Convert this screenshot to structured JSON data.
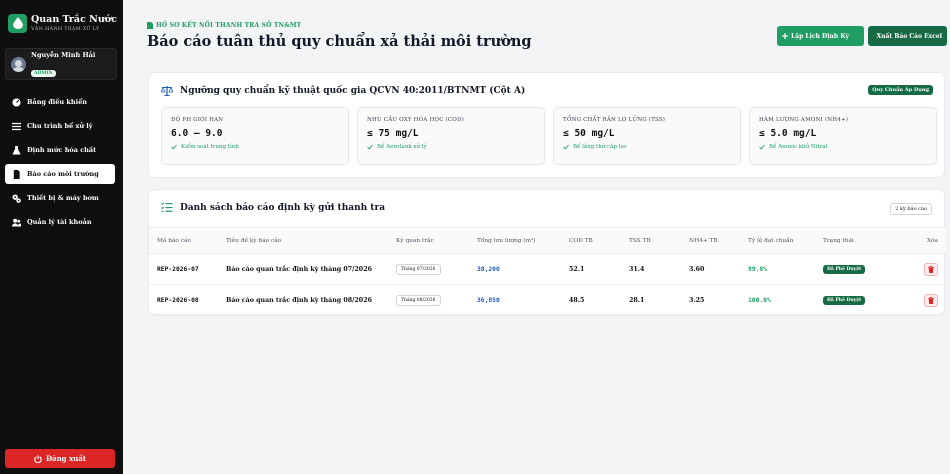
{
  "brand": {
    "title": "Quan Trắc Nước",
    "subtitle": "VẬN HÀNH TRẠM XỬ LÝ"
  },
  "user": {
    "name": "Nguyễn Minh Hải",
    "role": "ADMIN"
  },
  "nav": [
    {
      "label": "Bảng điều khiển",
      "icon": "speedometer-icon"
    },
    {
      "label": "Chu trình bể xử lý",
      "icon": "list-lines-icon"
    },
    {
      "label": "Định mức hóa chất",
      "icon": "flask-icon"
    },
    {
      "label": "Báo cáo môi trường",
      "icon": "document-icon",
      "active": true
    },
    {
      "label": "Thiết bị & máy bơm",
      "icon": "gears-icon"
    },
    {
      "label": "Quản lý tài khoản",
      "icon": "users-icon"
    }
  ],
  "logout_label": "Đăng xuất",
  "header": {
    "breadcrumb": "HỒ SƠ KẾT NỐI THANH TRA SỞ TN&MT",
    "title": "Báo cáo tuân thủ quy chuẩn xả thải môi trường",
    "schedule_label": "Lập Lịch Định Kỳ",
    "export_label": "Xuất Báo Cáo Excel"
  },
  "standard": {
    "title": "Ngưỡng quy chuẩn kỹ thuật quốc gia QCVN 40:2011/BTNMT (Cột A)",
    "tag": "Quy Chuẩn Áp Dụng",
    "metrics": [
      {
        "label": "ĐỘ PH GIỚI HẠN",
        "value": "6.0 – 9.0",
        "note": "Kiểm soát trung tính"
      },
      {
        "label": "NHU CẦU OXY HÓA HỌC (COD)",
        "value": "≤ 75 mg/L",
        "note": "Bể Aerotank xử lý"
      },
      {
        "label": "TỔNG CHẤT RẮN LƠ LỬNG (TSS)",
        "value": "≤ 50 mg/L",
        "note": "Bể lắng thứ cấp lọc"
      },
      {
        "label": "HÀM LƯỢNG AMONI (NH4+)",
        "value": "≤ 5.0 mg/L",
        "note": "Bể Anoxic khử Nitrat"
      }
    ]
  },
  "reports": {
    "title": "Danh sách báo cáo định kỳ gửi thanh tra",
    "count_label": "2 kỳ báo cáo",
    "columns": [
      "Mã báo cáo",
      "Tiêu đề kỳ báo cáo",
      "Kỳ quan trắc",
      "Tổng lưu lượng (m³)",
      "COD TB",
      "TSS TB",
      "NH4+ TB",
      "Tỷ lệ đạt chuẩn",
      "Trạng thái",
      "Xóa"
    ],
    "rows": [
      {
        "code": "REP-2026-07",
        "title": "Báo cáo quan trắc định kỳ tháng 07/2026",
        "period": "Tháng 07/2026",
        "flow": "38,200",
        "cod": "52.1",
        "tss": "31.4",
        "nh4": "3.60",
        "rate": "99.8%",
        "status": "Đã Phê Duyệt"
      },
      {
        "code": "REP-2026-08",
        "title": "Báo cáo quan trắc định kỳ tháng 08/2026",
        "period": "Tháng 08/2026",
        "flow": "36,850",
        "cod": "48.5",
        "tss": "28.1",
        "nh4": "3.25",
        "rate": "100.0%",
        "status": "Đã Phê Duyệt"
      }
    ]
  },
  "colors": {
    "accent": "#1f9d63",
    "accent_dark": "#166b45",
    "danger": "#dc2626",
    "sidebar_bg": "#0f0f10",
    "link_blue": "#1d5fb5"
  }
}
